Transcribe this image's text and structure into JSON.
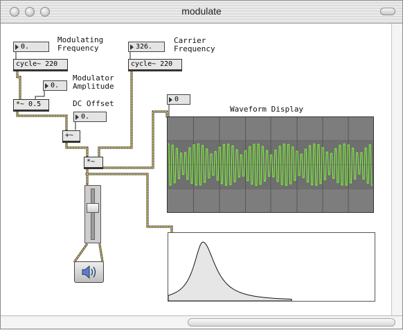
{
  "window": {
    "title": "modulate"
  },
  "labels": {
    "modulating_frequency": "Modulating\nFrequency",
    "carrier_frequency": "Carrier\nFrequency",
    "modulator_amplitude": "Modulator\nAmplitude",
    "dc_offset": "DC Offset",
    "waveform_display": "Waveform Display"
  },
  "number_boxes": {
    "modulating_frequency": "0.",
    "carrier_frequency": "326.",
    "modulator_amplitude": "0.",
    "dc_offset": "0.",
    "scope_control": "0"
  },
  "objects": {
    "cycle_modulator": "cycle~ 220",
    "cycle_carrier": "cycle~ 220",
    "mult_amplitude": "*~ 0.5",
    "add_offset": "+~",
    "mult_ring": "*~"
  },
  "slider": {
    "level": 0.35
  },
  "colors": {
    "scope_background": "#7d7d7d",
    "scope_trace": "#7cff2e",
    "patch_cord_signal": "#e0c860",
    "spectrum_fill": "#e6e6e6"
  },
  "icons": {
    "speaker": "speaker-icon"
  }
}
